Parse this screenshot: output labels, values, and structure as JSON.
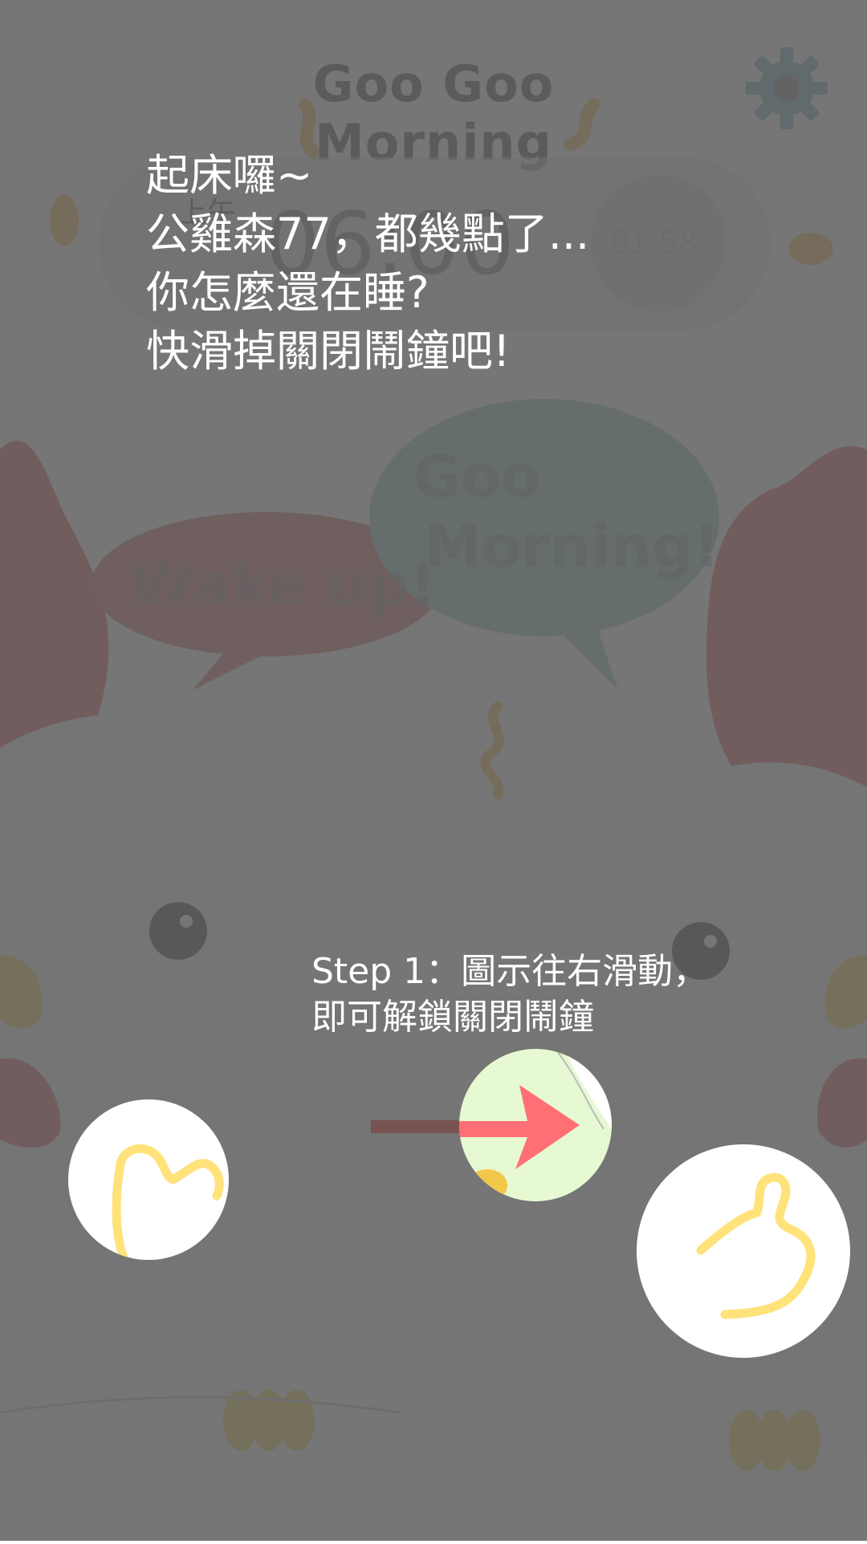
{
  "header": {
    "app_title": "Goo Goo Morning",
    "settings_icon": "gear-icon"
  },
  "alarm": {
    "ampm": "上午",
    "time": "06:00",
    "countdown": "01:58"
  },
  "speech_bubbles": {
    "left": "Wake up!",
    "right_line1": "Goo",
    "right_line2": "Morning!"
  },
  "tutorial": {
    "message_lines": [
      "起床囉~",
      "公雞森77，都幾點了...",
      "你怎麼還在睡?",
      "快滑掉關閉鬧鐘吧!"
    ],
    "step_lines": [
      "Step 1：圖示往右滑動，",
      "即可解鎖關閉鬧鐘"
    ]
  },
  "icons": {
    "left_highlight": "thumbs-up-icon",
    "drag_target": "swipe-right-arrow-icon",
    "right_highlight": "thumbs-up-icon"
  },
  "colors": {
    "overlay": "#5f5f5f",
    "arrow": "#ff6f73",
    "drag_circle": "#e6f9d2",
    "thumb": "#ffe27a",
    "chick_red": "#e04f57",
    "bubble_blue": "#8fbfbf"
  }
}
